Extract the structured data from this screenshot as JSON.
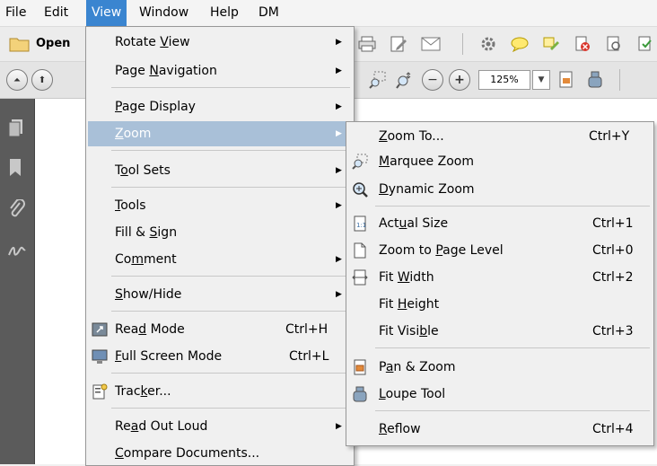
{
  "menubar": {
    "items": [
      "File",
      "Edit",
      "View",
      "Window",
      "Help",
      "DM"
    ],
    "active": "View"
  },
  "toolbar": {
    "open_label": "Open",
    "zoom_value": "125%"
  },
  "view_menu": {
    "items": [
      {
        "pre": "Rotate ",
        "u": "V",
        "post": "iew",
        "submenu": true
      },
      {
        "pre": "Page ",
        "u": "N",
        "post": "avigation",
        "submenu": true
      },
      {
        "pre": "",
        "u": "P",
        "post": "age Display",
        "submenu": true
      },
      {
        "pre": "",
        "u": "Z",
        "post": "oom",
        "submenu": true,
        "highlighted": true
      },
      {
        "pre": "T",
        "u": "o",
        "post": "ol Sets",
        "submenu": true
      },
      {
        "pre": "",
        "u": "T",
        "post": "ools",
        "submenu": true
      },
      {
        "pre": "Fill & ",
        "u": "S",
        "post": "ign",
        "submenu": false
      },
      {
        "pre": "Co",
        "u": "m",
        "post": "ment",
        "submenu": true
      },
      {
        "pre": "",
        "u": "S",
        "post": "how/Hide",
        "submenu": true
      },
      {
        "pre": "Rea",
        "u": "d",
        "post": " Mode",
        "shortcut": "Ctrl+H",
        "icon": "read-mode-icon"
      },
      {
        "pre": "",
        "u": "F",
        "post": "ull Screen Mode",
        "shortcut": "Ctrl+L",
        "icon": "full-screen-icon"
      },
      {
        "pre": "Trac",
        "u": "k",
        "post": "er...",
        "icon": "tracker-icon"
      },
      {
        "pre": "Re",
        "u": "a",
        "post": "d Out Loud",
        "submenu": true
      },
      {
        "pre": "",
        "u": "C",
        "post": "ompare Documents..."
      }
    ]
  },
  "zoom_menu": {
    "items": [
      {
        "pre": "",
        "u": "Z",
        "post": "oom To...",
        "shortcut": "Ctrl+Y"
      },
      {
        "pre": "",
        "u": "M",
        "post": "arquee Zoom",
        "icon": "marquee-zoom-icon"
      },
      {
        "pre": "",
        "u": "D",
        "post": "ynamic Zoom",
        "icon": "dynamic-zoom-icon"
      },
      {
        "pre": "Act",
        "u": "u",
        "post": "al Size",
        "shortcut": "Ctrl+1",
        "icon": "actual-size-icon"
      },
      {
        "pre": "Zoom to ",
        "u": "P",
        "post": "age Level",
        "shortcut": "Ctrl+0",
        "icon": "page-level-icon"
      },
      {
        "pre": "Fit ",
        "u": "W",
        "post": "idth",
        "shortcut": "Ctrl+2",
        "icon": "fit-width-icon"
      },
      {
        "pre": "Fit ",
        "u": "H",
        "post": "eight"
      },
      {
        "pre": "Fit Visi",
        "u": "b",
        "post": "le",
        "shortcut": "Ctrl+3"
      },
      {
        "pre": "P",
        "u": "a",
        "post": "n & Zoom",
        "icon": "pan-zoom-icon"
      },
      {
        "pre": "",
        "u": "L",
        "post": "oupe Tool",
        "icon": "loupe-tool-icon"
      },
      {
        "pre": "",
        "u": "R",
        "post": "eflow",
        "shortcut": "Ctrl+4"
      }
    ]
  }
}
